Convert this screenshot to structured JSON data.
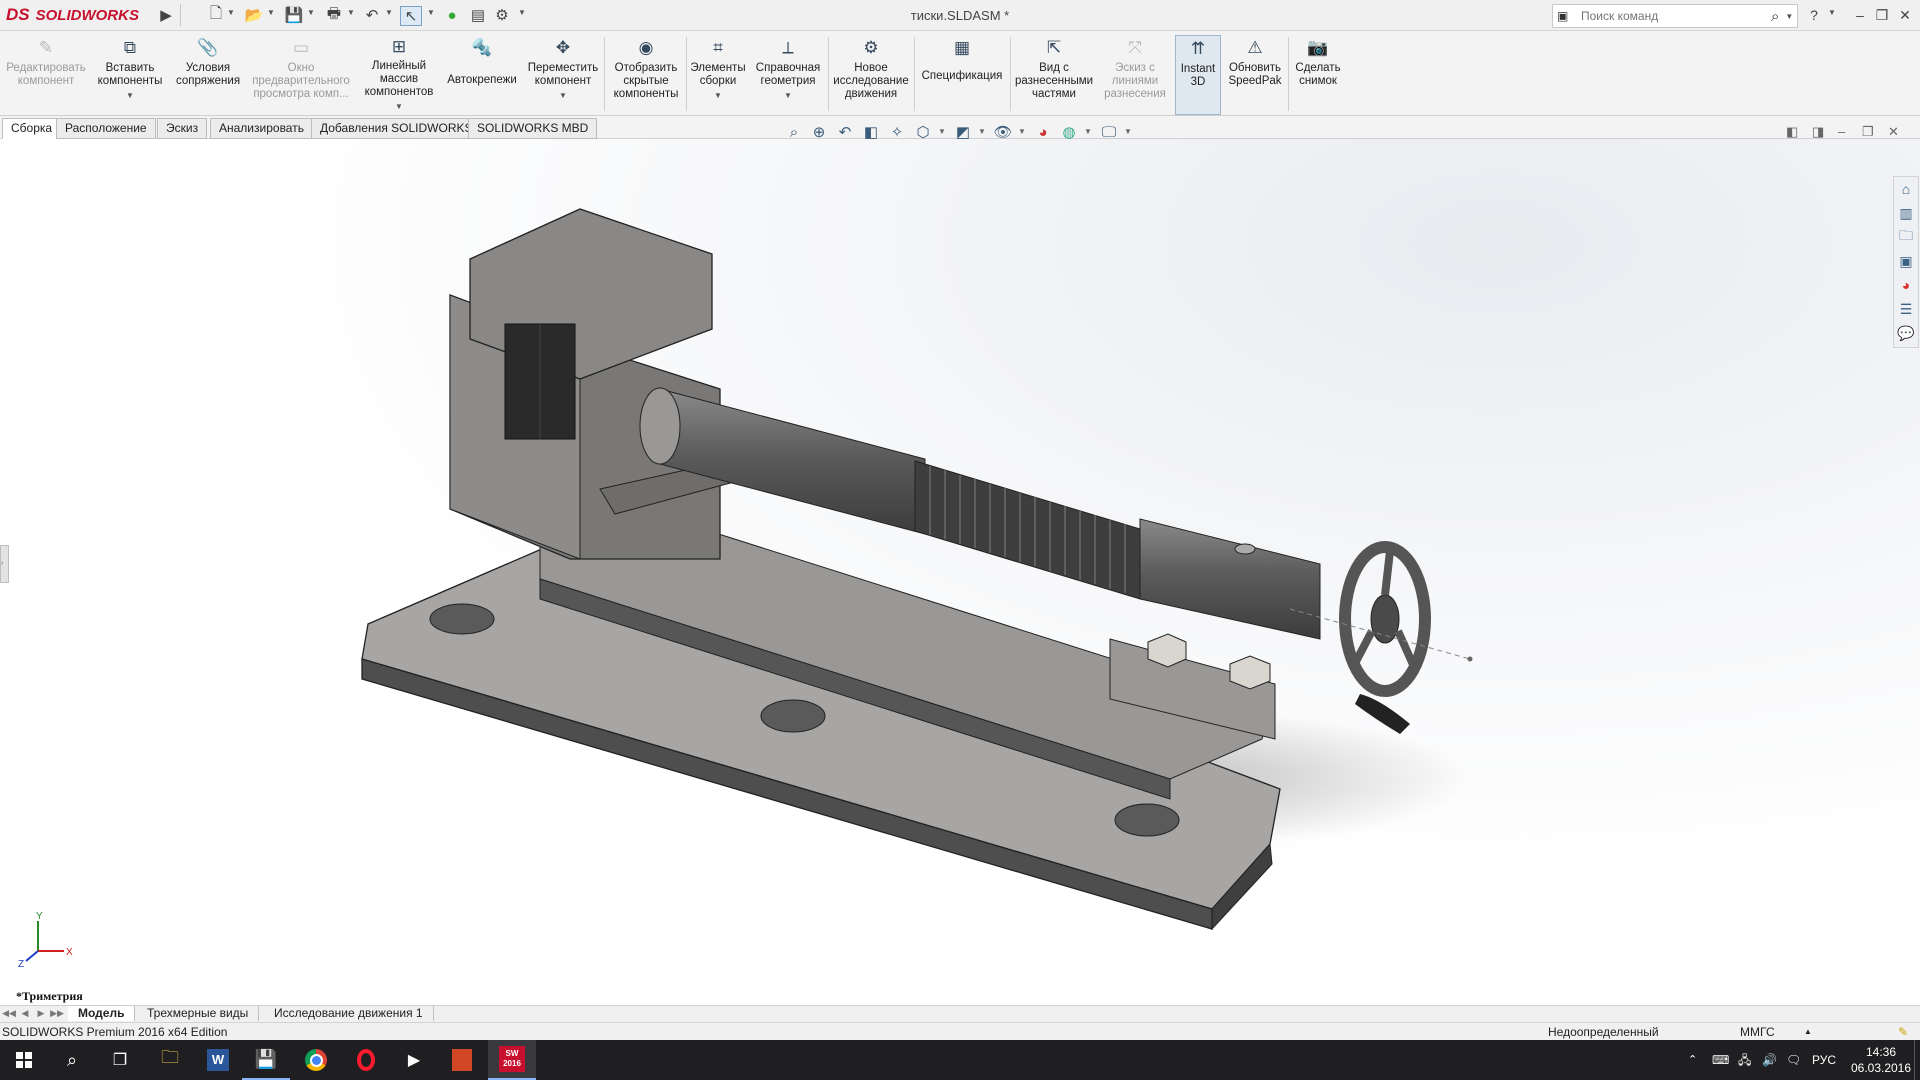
{
  "titlebar": {
    "app_logo": "SOLIDWORKS",
    "logo_mark": "DS",
    "document_title": "тиски.SLDASM *",
    "search_placeholder": "Поиск команд",
    "help_label": "?",
    "icons": [
      "expand-arrow-icon",
      "new-document-icon",
      "open-folder-icon",
      "save-icon",
      "print-icon",
      "undo-icon",
      "select-arrow-icon",
      "rebuild-traffic-light-icon",
      "file-properties-icon",
      "options-gear-icon",
      "search-icon",
      "help-icon",
      "minimize-icon",
      "restore-icon",
      "close-icon"
    ]
  },
  "command_manager": {
    "tools": [
      {
        "label": "Редактировать компонент",
        "icon": "edit-component-icon",
        "enabled": false
      },
      {
        "label": "Вставить компоненты",
        "icon": "insert-components-icon",
        "enabled": true,
        "has_dropdown": true
      },
      {
        "label": "Условия сопряжения",
        "icon": "mate-icon",
        "enabled": true
      },
      {
        "label": "Окно предварительного просмотра комп...",
        "icon": "component-preview-window-icon",
        "enabled": false
      },
      {
        "label": "Линейный массив компонентов",
        "icon": "linear-component-pattern-icon",
        "enabled": true,
        "has_dropdown": true
      },
      {
        "label": "Автокрепежи",
        "icon": "smart-fasteners-icon",
        "enabled": true
      },
      {
        "label": "Переместить компонент",
        "icon": "move-component-icon",
        "enabled": true,
        "has_dropdown": true
      },
      {
        "label": "Отобразить скрытые компоненты",
        "icon": "show-hidden-components-icon",
        "enabled": true
      },
      {
        "label": "Элементы сборки",
        "icon": "assembly-features-icon",
        "enabled": true,
        "has_dropdown": true
      },
      {
        "label": "Справочная геометрия",
        "icon": "reference-geometry-icon",
        "enabled": true,
        "has_dropdown": true
      },
      {
        "label": "Новое исследование движения",
        "icon": "new-motion-study-icon",
        "enabled": true
      },
      {
        "label": "Спецификация",
        "icon": "bill-of-materials-icon",
        "enabled": true
      },
      {
        "label": "Вид с разнесенными частями",
        "icon": "exploded-view-icon",
        "enabled": true
      },
      {
        "label": "Эскиз с линиями разнесения",
        "icon": "explode-line-sketch-icon",
        "enabled": false
      },
      {
        "label": "Instant 3D",
        "icon": "instant-3d-icon",
        "enabled": true,
        "active": true
      },
      {
        "label": "Обновить SpeedPak",
        "icon": "update-speedpak-icon",
        "enabled": true
      },
      {
        "label": "Сделать снимок",
        "icon": "take-snapshot-icon",
        "enabled": true
      }
    ]
  },
  "tabs": [
    "Сборка",
    "Расположение",
    "Эскиз",
    "Анализировать",
    "Добавления SOLIDWORKS",
    "SOLIDWORKS MBD"
  ],
  "active_tab": "Сборка",
  "heads_up_toolbar": [
    "zoom-to-fit-icon",
    "zoom-to-area-icon",
    "previous-view-icon",
    "section-view-icon",
    "dynamic-annotation-icon",
    "view-orientation-icon",
    "display-style-icon",
    "hide-show-items-icon",
    "edit-appearance-icon",
    "apply-scene-icon",
    "view-settings-icon"
  ],
  "viewport_controls": [
    "tile-left-icon",
    "tile-right-icon",
    "minimize-view-icon",
    "restore-view-icon",
    "close-view-icon"
  ],
  "task_pane": [
    "solidworks-resources-icon",
    "design-library-icon",
    "file-explorer-icon",
    "view-palette-icon",
    "appearances-icon",
    "custom-properties-icon",
    "forum-icon"
  ],
  "triad": {
    "x": "X",
    "y": "Y",
    "z": "Z"
  },
  "view_label": "*Триметрия",
  "bottom_tabs": [
    "Модель",
    "Трехмерные виды",
    "Исследование движения 1"
  ],
  "active_bottom_tab": "Модель",
  "status_bar": {
    "product": "SOLIDWORKS Premium 2016 x64 Edition",
    "state": "Недоопределенный",
    "units": "ММГС",
    "units_arrow": "▲"
  },
  "taskbar": {
    "apps": [
      "windows-start-icon",
      "search-icon",
      "task-view-icon",
      "file-explorer-icon",
      "word-icon",
      "floppy-save-icon",
      "chrome-icon",
      "opera-icon",
      "media-player-icon",
      "office-app-icon",
      "solidworks-2016-icon"
    ],
    "sw_badge": "SW\n2016",
    "language": "РУС",
    "time": "14:36",
    "date": "06.03.2016"
  }
}
